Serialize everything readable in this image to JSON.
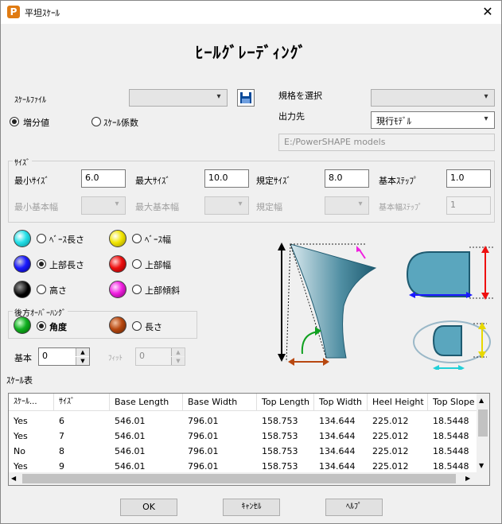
{
  "window": {
    "title": "平坦ｽｹｰﾙ",
    "app_icon": "P"
  },
  "heading": "ﾋｰﾙｸﾞﾚｰﾃﾞｨﾝｸﾞ",
  "scale_file": {
    "label": "ｽｹｰﾙﾌｧｲﾙ",
    "value": ""
  },
  "mode": {
    "increment": "増分値",
    "factor": "ｽｹｰﾙ係数",
    "selected": "increment"
  },
  "standard": {
    "label": "規格を選択",
    "value": ""
  },
  "output": {
    "label": "出力先",
    "value": "現行ﾓﾃﾞﾙ",
    "path": "E:/PowerSHAPE models"
  },
  "size": {
    "group_label": "ｻｲｽﾞ",
    "min_label": "最小ｻｲｽﾞ",
    "min": "6.0",
    "max_label": "最大ｻｲｽﾞ",
    "max": "10.0",
    "std_label": "規定ｻｲｽﾞ",
    "std": "8.0",
    "step_label": "基本ｽﾃｯﾌﾟ",
    "step": "1.0",
    "minw_label": "最小基本幅",
    "maxw_label": "最大基本幅",
    "stdw_label": "規定幅",
    "wstep_label": "基本幅ｽﾃｯﾌﾟ",
    "wstep": "1"
  },
  "params": {
    "base_length": "ﾍﾞｰｽ長さ",
    "base_width": "ﾍﾞｰｽ幅",
    "top_length": "上部長さ",
    "top_width": "上部幅",
    "height": "高さ",
    "top_slope": "上部傾斜",
    "selected": "top_length",
    "colors": {
      "cyan": "#22e0e8",
      "yellow": "#f2e600",
      "blue": "#1a1aff",
      "red": "#ee1010",
      "black": "#000000",
      "magenta": "#f020e0",
      "green": "#10b020",
      "brown": "#b84810"
    }
  },
  "overhang": {
    "group_label": "後方ｵｰﾊﾞｰﾊﾝｸﾞ",
    "angle": "角度",
    "length": "長さ",
    "selected": "angle"
  },
  "base": {
    "label": "基本",
    "value": "0",
    "fit_label": "ﾌｨｯﾄ",
    "fit_value": "0"
  },
  "table": {
    "label": "ｽｹｰﾙ表",
    "columns": [
      "ｽｹｰﾙ...",
      "ｻｲｽﾞ",
      "Base Length",
      "Base Width",
      "Top Length",
      "Top Width",
      "Heel Height",
      "Top Slope"
    ],
    "rows": [
      [
        "Yes",
        "6",
        "546.01",
        "796.01",
        "158.753",
        "134.644",
        "225.012",
        "18.5448"
      ],
      [
        "Yes",
        "7",
        "546.01",
        "796.01",
        "158.753",
        "134.644",
        "225.012",
        "18.5448"
      ],
      [
        "No",
        "8",
        "546.01",
        "796.01",
        "158.753",
        "134.644",
        "225.012",
        "18.5448"
      ],
      [
        "Yes",
        "9",
        "546.01",
        "796.01",
        "158.753",
        "134.644",
        "225.012",
        "18.5448"
      ]
    ]
  },
  "buttons": {
    "ok": "OK",
    "cancel": "ｷｬﾝｾﾙ",
    "help": "ﾍﾙﾌﾟ"
  }
}
